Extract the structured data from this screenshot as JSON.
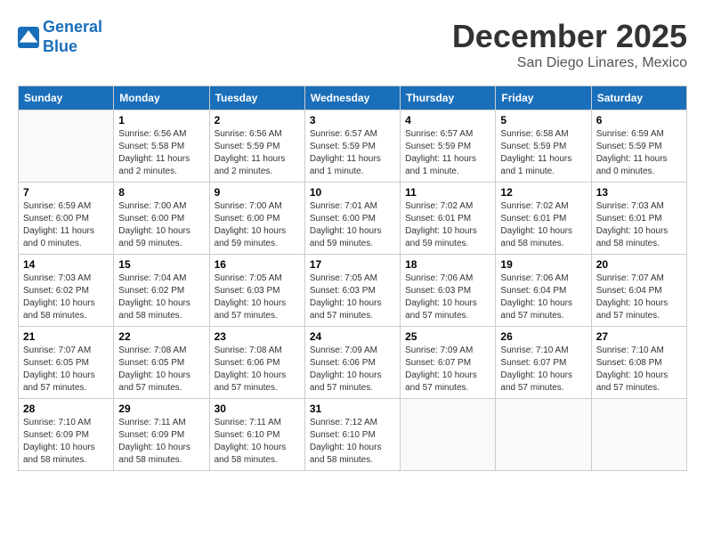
{
  "header": {
    "logo_line1": "General",
    "logo_line2": "Blue",
    "title": "December 2025",
    "subtitle": "San Diego Linares, Mexico"
  },
  "weekdays": [
    "Sunday",
    "Monday",
    "Tuesday",
    "Wednesday",
    "Thursday",
    "Friday",
    "Saturday"
  ],
  "weeks": [
    [
      {
        "day": "",
        "info": ""
      },
      {
        "day": "1",
        "info": "Sunrise: 6:56 AM\nSunset: 5:58 PM\nDaylight: 11 hours\nand 2 minutes."
      },
      {
        "day": "2",
        "info": "Sunrise: 6:56 AM\nSunset: 5:59 PM\nDaylight: 11 hours\nand 2 minutes."
      },
      {
        "day": "3",
        "info": "Sunrise: 6:57 AM\nSunset: 5:59 PM\nDaylight: 11 hours\nand 1 minute."
      },
      {
        "day": "4",
        "info": "Sunrise: 6:57 AM\nSunset: 5:59 PM\nDaylight: 11 hours\nand 1 minute."
      },
      {
        "day": "5",
        "info": "Sunrise: 6:58 AM\nSunset: 5:59 PM\nDaylight: 11 hours\nand 1 minute."
      },
      {
        "day": "6",
        "info": "Sunrise: 6:59 AM\nSunset: 5:59 PM\nDaylight: 11 hours\nand 0 minutes."
      }
    ],
    [
      {
        "day": "7",
        "info": "Sunrise: 6:59 AM\nSunset: 6:00 PM\nDaylight: 11 hours\nand 0 minutes."
      },
      {
        "day": "8",
        "info": "Sunrise: 7:00 AM\nSunset: 6:00 PM\nDaylight: 10 hours\nand 59 minutes."
      },
      {
        "day": "9",
        "info": "Sunrise: 7:00 AM\nSunset: 6:00 PM\nDaylight: 10 hours\nand 59 minutes."
      },
      {
        "day": "10",
        "info": "Sunrise: 7:01 AM\nSunset: 6:00 PM\nDaylight: 10 hours\nand 59 minutes."
      },
      {
        "day": "11",
        "info": "Sunrise: 7:02 AM\nSunset: 6:01 PM\nDaylight: 10 hours\nand 59 minutes."
      },
      {
        "day": "12",
        "info": "Sunrise: 7:02 AM\nSunset: 6:01 PM\nDaylight: 10 hours\nand 58 minutes."
      },
      {
        "day": "13",
        "info": "Sunrise: 7:03 AM\nSunset: 6:01 PM\nDaylight: 10 hours\nand 58 minutes."
      }
    ],
    [
      {
        "day": "14",
        "info": "Sunrise: 7:03 AM\nSunset: 6:02 PM\nDaylight: 10 hours\nand 58 minutes."
      },
      {
        "day": "15",
        "info": "Sunrise: 7:04 AM\nSunset: 6:02 PM\nDaylight: 10 hours\nand 58 minutes."
      },
      {
        "day": "16",
        "info": "Sunrise: 7:05 AM\nSunset: 6:03 PM\nDaylight: 10 hours\nand 57 minutes."
      },
      {
        "day": "17",
        "info": "Sunrise: 7:05 AM\nSunset: 6:03 PM\nDaylight: 10 hours\nand 57 minutes."
      },
      {
        "day": "18",
        "info": "Sunrise: 7:06 AM\nSunset: 6:03 PM\nDaylight: 10 hours\nand 57 minutes."
      },
      {
        "day": "19",
        "info": "Sunrise: 7:06 AM\nSunset: 6:04 PM\nDaylight: 10 hours\nand 57 minutes."
      },
      {
        "day": "20",
        "info": "Sunrise: 7:07 AM\nSunset: 6:04 PM\nDaylight: 10 hours\nand 57 minutes."
      }
    ],
    [
      {
        "day": "21",
        "info": "Sunrise: 7:07 AM\nSunset: 6:05 PM\nDaylight: 10 hours\nand 57 minutes."
      },
      {
        "day": "22",
        "info": "Sunrise: 7:08 AM\nSunset: 6:05 PM\nDaylight: 10 hours\nand 57 minutes."
      },
      {
        "day": "23",
        "info": "Sunrise: 7:08 AM\nSunset: 6:06 PM\nDaylight: 10 hours\nand 57 minutes."
      },
      {
        "day": "24",
        "info": "Sunrise: 7:09 AM\nSunset: 6:06 PM\nDaylight: 10 hours\nand 57 minutes."
      },
      {
        "day": "25",
        "info": "Sunrise: 7:09 AM\nSunset: 6:07 PM\nDaylight: 10 hours\nand 57 minutes."
      },
      {
        "day": "26",
        "info": "Sunrise: 7:10 AM\nSunset: 6:07 PM\nDaylight: 10 hours\nand 57 minutes."
      },
      {
        "day": "27",
        "info": "Sunrise: 7:10 AM\nSunset: 6:08 PM\nDaylight: 10 hours\nand 57 minutes."
      }
    ],
    [
      {
        "day": "28",
        "info": "Sunrise: 7:10 AM\nSunset: 6:09 PM\nDaylight: 10 hours\nand 58 minutes."
      },
      {
        "day": "29",
        "info": "Sunrise: 7:11 AM\nSunset: 6:09 PM\nDaylight: 10 hours\nand 58 minutes."
      },
      {
        "day": "30",
        "info": "Sunrise: 7:11 AM\nSunset: 6:10 PM\nDaylight: 10 hours\nand 58 minutes."
      },
      {
        "day": "31",
        "info": "Sunrise: 7:12 AM\nSunset: 6:10 PM\nDaylight: 10 hours\nand 58 minutes."
      },
      {
        "day": "",
        "info": ""
      },
      {
        "day": "",
        "info": ""
      },
      {
        "day": "",
        "info": ""
      }
    ]
  ]
}
